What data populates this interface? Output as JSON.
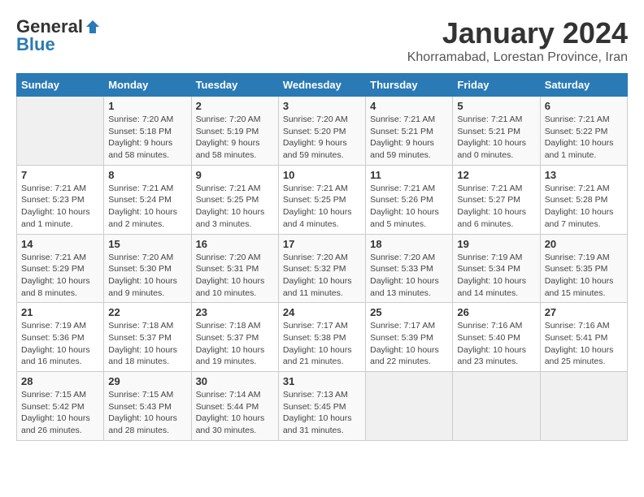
{
  "logo": {
    "general": "General",
    "blue": "Blue"
  },
  "title": "January 2024",
  "location": "Khorramabad, Lorestan Province, Iran",
  "days_of_week": [
    "Sunday",
    "Monday",
    "Tuesday",
    "Wednesday",
    "Thursday",
    "Friday",
    "Saturday"
  ],
  "weeks": [
    [
      {
        "day": "",
        "info": ""
      },
      {
        "day": "1",
        "info": "Sunrise: 7:20 AM\nSunset: 5:18 PM\nDaylight: 9 hours\nand 58 minutes."
      },
      {
        "day": "2",
        "info": "Sunrise: 7:20 AM\nSunset: 5:19 PM\nDaylight: 9 hours\nand 58 minutes."
      },
      {
        "day": "3",
        "info": "Sunrise: 7:20 AM\nSunset: 5:20 PM\nDaylight: 9 hours\nand 59 minutes."
      },
      {
        "day": "4",
        "info": "Sunrise: 7:21 AM\nSunset: 5:21 PM\nDaylight: 9 hours\nand 59 minutes."
      },
      {
        "day": "5",
        "info": "Sunrise: 7:21 AM\nSunset: 5:21 PM\nDaylight: 10 hours\nand 0 minutes."
      },
      {
        "day": "6",
        "info": "Sunrise: 7:21 AM\nSunset: 5:22 PM\nDaylight: 10 hours\nand 1 minute."
      }
    ],
    [
      {
        "day": "7",
        "info": "Sunrise: 7:21 AM\nSunset: 5:23 PM\nDaylight: 10 hours\nand 1 minute."
      },
      {
        "day": "8",
        "info": "Sunrise: 7:21 AM\nSunset: 5:24 PM\nDaylight: 10 hours\nand 2 minutes."
      },
      {
        "day": "9",
        "info": "Sunrise: 7:21 AM\nSunset: 5:25 PM\nDaylight: 10 hours\nand 3 minutes."
      },
      {
        "day": "10",
        "info": "Sunrise: 7:21 AM\nSunset: 5:25 PM\nDaylight: 10 hours\nand 4 minutes."
      },
      {
        "day": "11",
        "info": "Sunrise: 7:21 AM\nSunset: 5:26 PM\nDaylight: 10 hours\nand 5 minutes."
      },
      {
        "day": "12",
        "info": "Sunrise: 7:21 AM\nSunset: 5:27 PM\nDaylight: 10 hours\nand 6 minutes."
      },
      {
        "day": "13",
        "info": "Sunrise: 7:21 AM\nSunset: 5:28 PM\nDaylight: 10 hours\nand 7 minutes."
      }
    ],
    [
      {
        "day": "14",
        "info": "Sunrise: 7:21 AM\nSunset: 5:29 PM\nDaylight: 10 hours\nand 8 minutes."
      },
      {
        "day": "15",
        "info": "Sunrise: 7:20 AM\nSunset: 5:30 PM\nDaylight: 10 hours\nand 9 minutes."
      },
      {
        "day": "16",
        "info": "Sunrise: 7:20 AM\nSunset: 5:31 PM\nDaylight: 10 hours\nand 10 minutes."
      },
      {
        "day": "17",
        "info": "Sunrise: 7:20 AM\nSunset: 5:32 PM\nDaylight: 10 hours\nand 11 minutes."
      },
      {
        "day": "18",
        "info": "Sunrise: 7:20 AM\nSunset: 5:33 PM\nDaylight: 10 hours\nand 13 minutes."
      },
      {
        "day": "19",
        "info": "Sunrise: 7:19 AM\nSunset: 5:34 PM\nDaylight: 10 hours\nand 14 minutes."
      },
      {
        "day": "20",
        "info": "Sunrise: 7:19 AM\nSunset: 5:35 PM\nDaylight: 10 hours\nand 15 minutes."
      }
    ],
    [
      {
        "day": "21",
        "info": "Sunrise: 7:19 AM\nSunset: 5:36 PM\nDaylight: 10 hours\nand 16 minutes."
      },
      {
        "day": "22",
        "info": "Sunrise: 7:18 AM\nSunset: 5:37 PM\nDaylight: 10 hours\nand 18 minutes."
      },
      {
        "day": "23",
        "info": "Sunrise: 7:18 AM\nSunset: 5:37 PM\nDaylight: 10 hours\nand 19 minutes."
      },
      {
        "day": "24",
        "info": "Sunrise: 7:17 AM\nSunset: 5:38 PM\nDaylight: 10 hours\nand 21 minutes."
      },
      {
        "day": "25",
        "info": "Sunrise: 7:17 AM\nSunset: 5:39 PM\nDaylight: 10 hours\nand 22 minutes."
      },
      {
        "day": "26",
        "info": "Sunrise: 7:16 AM\nSunset: 5:40 PM\nDaylight: 10 hours\nand 23 minutes."
      },
      {
        "day": "27",
        "info": "Sunrise: 7:16 AM\nSunset: 5:41 PM\nDaylight: 10 hours\nand 25 minutes."
      }
    ],
    [
      {
        "day": "28",
        "info": "Sunrise: 7:15 AM\nSunset: 5:42 PM\nDaylight: 10 hours\nand 26 minutes."
      },
      {
        "day": "29",
        "info": "Sunrise: 7:15 AM\nSunset: 5:43 PM\nDaylight: 10 hours\nand 28 minutes."
      },
      {
        "day": "30",
        "info": "Sunrise: 7:14 AM\nSunset: 5:44 PM\nDaylight: 10 hours\nand 30 minutes."
      },
      {
        "day": "31",
        "info": "Sunrise: 7:13 AM\nSunset: 5:45 PM\nDaylight: 10 hours\nand 31 minutes."
      },
      {
        "day": "",
        "info": ""
      },
      {
        "day": "",
        "info": ""
      },
      {
        "day": "",
        "info": ""
      }
    ]
  ]
}
